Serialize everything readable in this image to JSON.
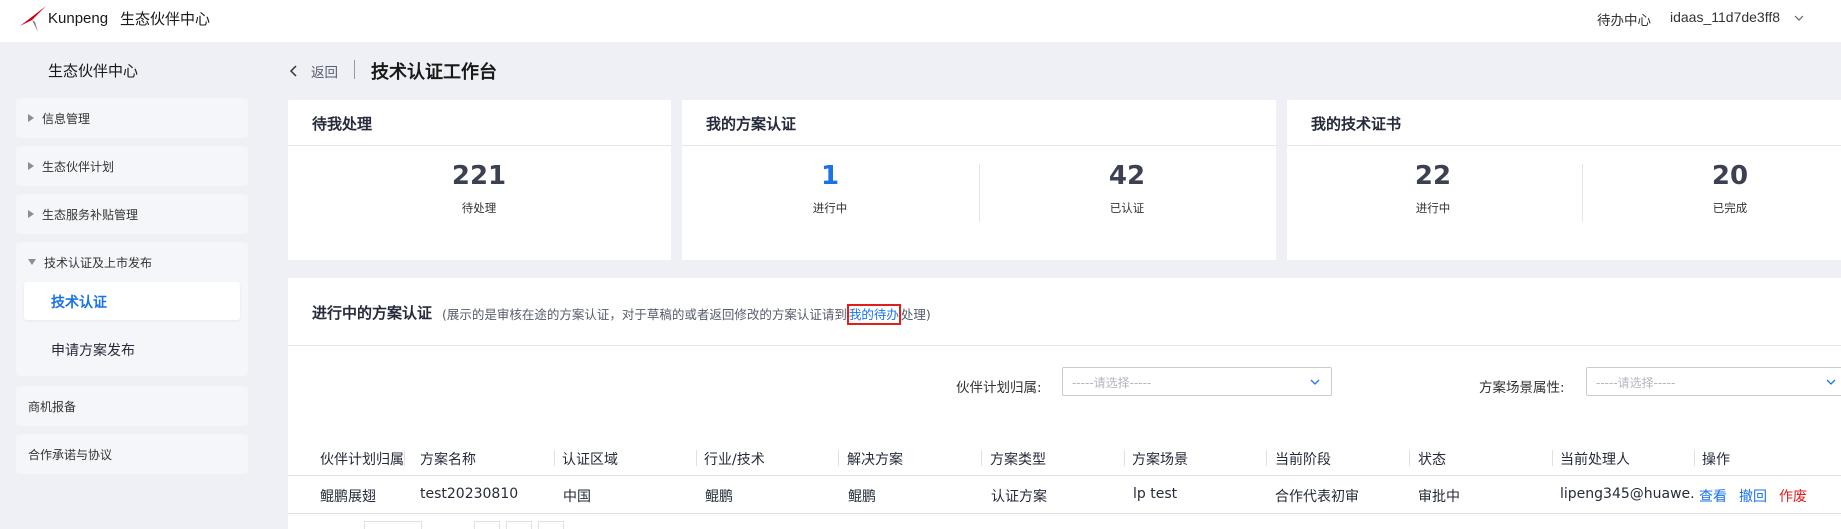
{
  "topbar": {
    "brand": "Kunpeng",
    "site_name": "生态伙伴中心",
    "todo_center": "待办中心",
    "username": "idaas_11d7de3ff8",
    "logo_color": "#c7000b"
  },
  "sidebar": {
    "title": "生态伙伴中心",
    "items": [
      {
        "label": "信息管理"
      },
      {
        "label": "生态伙伴计划"
      },
      {
        "label": "生态服务补贴管理"
      },
      {
        "label": "技术认证及上市发布",
        "expanded": true,
        "children": [
          {
            "label": "技术认证",
            "active": true
          },
          {
            "label": "申请方案发布"
          }
        ]
      },
      {
        "label": "商机报备"
      },
      {
        "label": "合作承诺与协议"
      }
    ]
  },
  "header": {
    "back_label": "返回",
    "title": "技术认证工作台"
  },
  "cards": {
    "pending": {
      "title": "待我处理",
      "stats": [
        {
          "value": "221",
          "label": "待处理"
        }
      ]
    },
    "solutions": {
      "title": "我的方案认证",
      "stats": [
        {
          "value": "1",
          "label": "进行中"
        },
        {
          "value": "42",
          "label": "已认证"
        }
      ]
    },
    "certificates": {
      "title": "我的技术证书",
      "stats": [
        {
          "value": "22",
          "label": "进行中"
        },
        {
          "value": "20",
          "label": "已完成"
        }
      ]
    }
  },
  "panel": {
    "title": "进行中的方案认证",
    "note_prefix": "(展示的是审核在途的方案认证，对于草稿的或者返回修改的方案认证请到",
    "note_link": "我的待办",
    "note_suffix": "处理)",
    "filters": [
      {
        "label": "伙伴计划归属:",
        "placeholder": "-----请选择-----"
      },
      {
        "label": "方案场景属性:",
        "placeholder": "-----请选择-----"
      }
    ],
    "columns": [
      "伙伴计划归属",
      "方案名称",
      "认证区域",
      "行业/技术",
      "解决方案",
      "方案类型",
      "方案场景",
      "当前阶段",
      "状态",
      "当前处理人",
      "操作"
    ],
    "rows": [
      {
        "cells": [
          "鲲鹏展翅",
          "test20230810",
          "中国",
          "鲲鹏",
          "鲲鹏",
          "认证方案",
          "lp test",
          "合作代表初审",
          "审批中",
          "lipeng345@huawe..."
        ],
        "actions": {
          "view": "查看",
          "withdraw": "撤回",
          "void": "作废"
        }
      }
    ],
    "colors": {
      "link": "#1a73e8",
      "danger": "#e01e1e"
    }
  }
}
